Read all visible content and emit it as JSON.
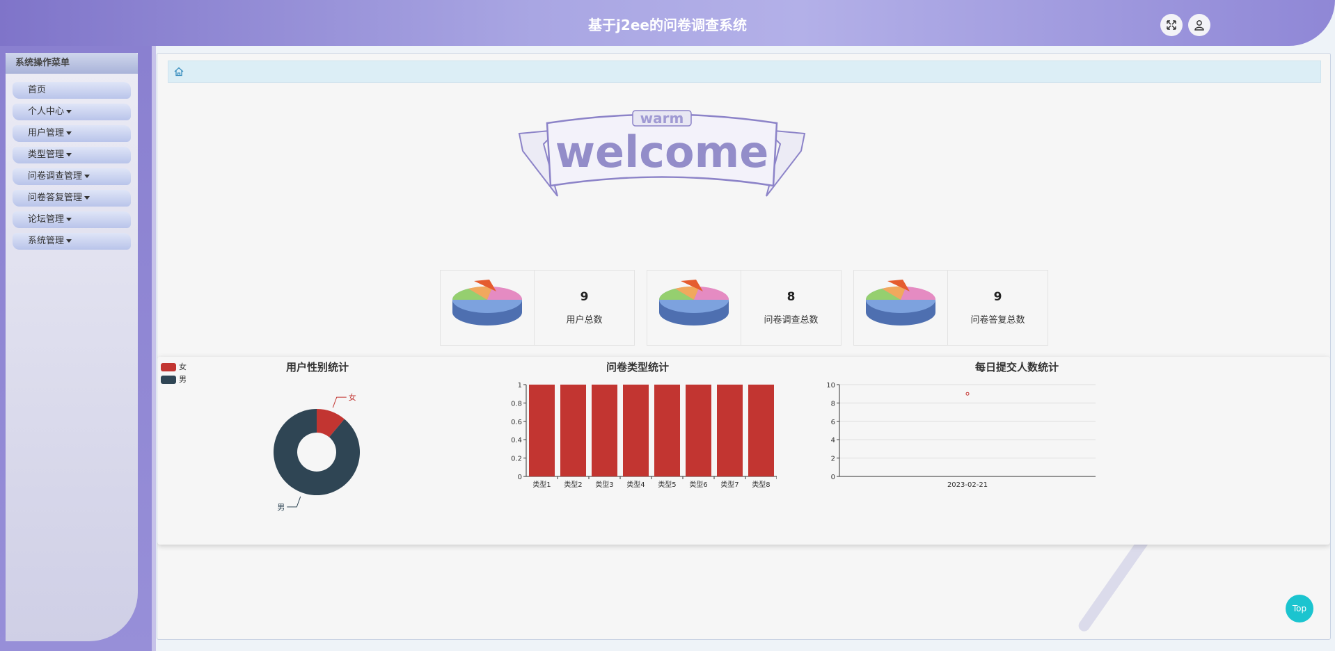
{
  "header": {
    "title": "基于j2ee的问卷调查系统"
  },
  "sidebar": {
    "heading": "系统操作菜单",
    "items": [
      {
        "label": "首页",
        "has_caret": false
      },
      {
        "label": "个人中心",
        "has_caret": true
      },
      {
        "label": "用户管理",
        "has_caret": true
      },
      {
        "label": "类型管理",
        "has_caret": true
      },
      {
        "label": "问卷调查管理",
        "has_caret": true
      },
      {
        "label": "问卷答复管理",
        "has_caret": true
      },
      {
        "label": "论坛管理",
        "has_caret": true
      },
      {
        "label": "系统管理",
        "has_caret": true
      }
    ]
  },
  "banner": {
    "small_text": "warm",
    "big_text": "welcome"
  },
  "stats": [
    {
      "value": "9",
      "label": "用户总数"
    },
    {
      "value": "8",
      "label": "问卷调查总数"
    },
    {
      "value": "9",
      "label": "问卷答复总数"
    }
  ],
  "colors": {
    "female": "#c23531",
    "male": "#2f4554",
    "accent": "#1bc4cf"
  },
  "top_button": "Top",
  "chart_data": [
    {
      "type": "pie",
      "title": "用户性别统计",
      "legend": [
        "女",
        "男"
      ],
      "legend_position": "top-left",
      "slices": [
        {
          "name": "女",
          "value": 1
        },
        {
          "name": "男",
          "value": 8
        }
      ],
      "donut": true
    },
    {
      "type": "bar",
      "title": "问卷类型统计",
      "categories": [
        "类型1",
        "类型2",
        "类型3",
        "类型4",
        "类型5",
        "类型6",
        "类型7",
        "类型8"
      ],
      "values": [
        1,
        1,
        1,
        1,
        1,
        1,
        1,
        1
      ],
      "ylim": [
        0,
        1
      ],
      "yticks": [
        "0",
        "0.2",
        "0.4",
        "0.6",
        "0.8",
        "1"
      ]
    },
    {
      "type": "scatter",
      "title": "每日提交人数统计",
      "categories": [
        "2023-02-21"
      ],
      "values": [
        9
      ],
      "ylim": [
        0,
        10
      ],
      "yticks": [
        "0",
        "2",
        "4",
        "6",
        "8",
        "10"
      ],
      "grid": true
    }
  ]
}
